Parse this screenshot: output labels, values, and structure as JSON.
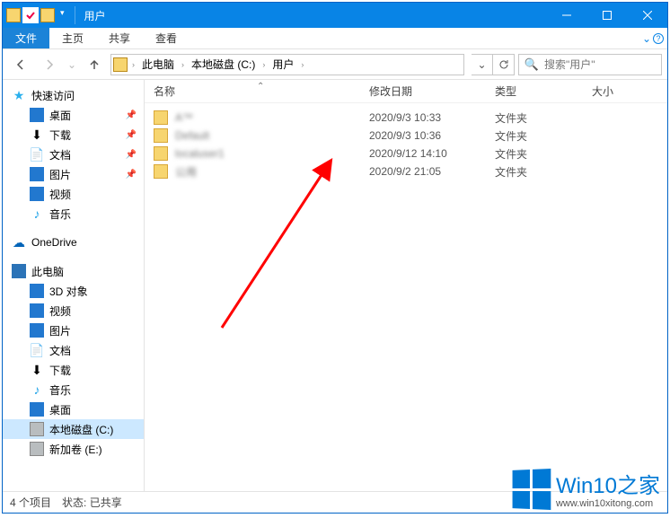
{
  "window": {
    "title": "用户"
  },
  "menus": {
    "file": "文件",
    "home": "主页",
    "share": "共享",
    "view": "查看"
  },
  "breadcrumb": [
    "此电脑",
    "本地磁盘 (C:)",
    "用户"
  ],
  "search": {
    "placeholder": "搜索\"用户\""
  },
  "sidebar": {
    "quick": "快速访问",
    "quick_items": [
      {
        "label": "桌面",
        "pin": true
      },
      {
        "label": "下载",
        "pin": true
      },
      {
        "label": "文档",
        "pin": true
      },
      {
        "label": "图片",
        "pin": true
      },
      {
        "label": "视频"
      },
      {
        "label": "音乐"
      }
    ],
    "onedrive": "OneDrive",
    "thispc": "此电脑",
    "pc_items": [
      "3D 对象",
      "视频",
      "图片",
      "文档",
      "下载",
      "音乐",
      "桌面",
      "本地磁盘 (C:)",
      "新加卷 (E:)"
    ]
  },
  "columns": {
    "name": "名称",
    "date": "修改日期",
    "type": "类型",
    "size": "大小"
  },
  "rows": [
    {
      "name": "A™",
      "date": "2020/9/3 10:33",
      "type": "文件夹"
    },
    {
      "name": "Default",
      "date": "2020/9/3 10:36",
      "type": "文件夹"
    },
    {
      "name": "localuser1",
      "date": "2020/9/12 14:10",
      "type": "文件夹"
    },
    {
      "name": "公用",
      "date": "2020/9/2 21:05",
      "type": "文件夹"
    }
  ],
  "status": {
    "count": "4 个项目",
    "state_label": "状态:",
    "state_value": "已共享"
  },
  "watermark": {
    "brand": "Win10之家",
    "url": "www.win10xitong.com"
  }
}
